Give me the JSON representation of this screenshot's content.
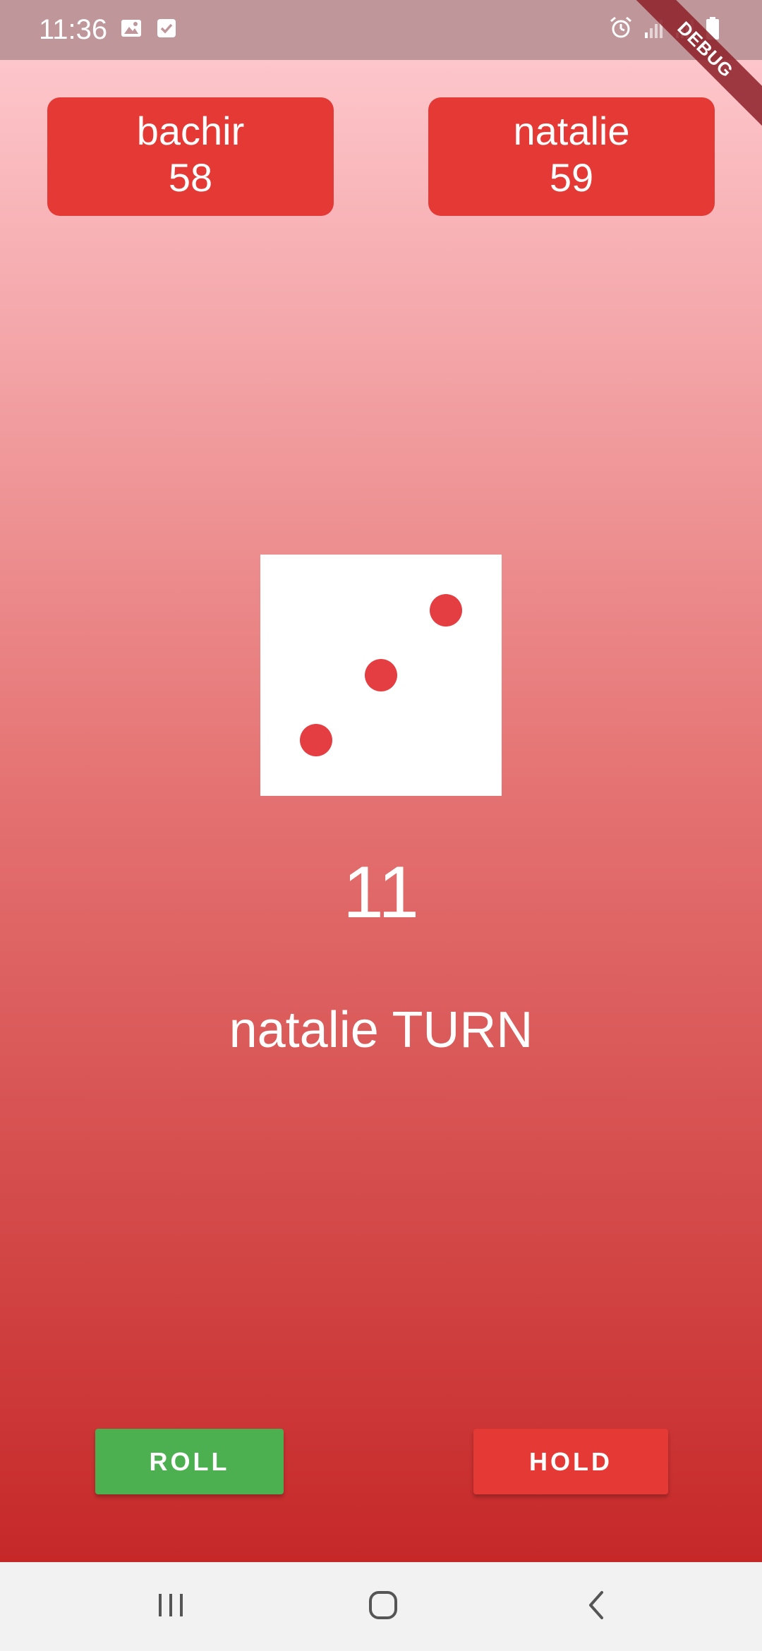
{
  "status_bar": {
    "time": "11:36",
    "icons": [
      "image-icon",
      "checkbox-icon",
      "alarm-icon",
      "signal-icon",
      "signal-icon",
      "battery-icon"
    ]
  },
  "debug_banner": {
    "label": "DEBUG"
  },
  "players": [
    {
      "name": "bachir",
      "score": "58"
    },
    {
      "name": "natalie",
      "score": "59"
    }
  ],
  "die": {
    "value": 3
  },
  "current_score": "11",
  "turn_label": "natalie TURN",
  "buttons": {
    "roll_label": "ROLL",
    "hold_label": "HOLD"
  },
  "colors": {
    "gradient_top": "#ffcdd2",
    "gradient_bottom": "#c62828",
    "card": "#e53935",
    "roll": "#4caf50",
    "hold": "#e53935",
    "pip": "#e53e42"
  },
  "nav_bar": {
    "icons": [
      "recents-icon",
      "home-icon",
      "back-icon"
    ]
  }
}
